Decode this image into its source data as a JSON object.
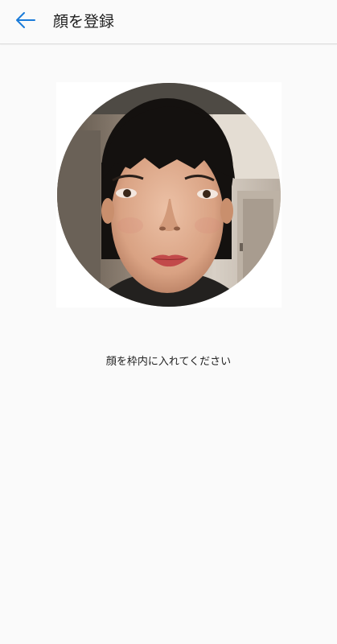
{
  "header": {
    "title": "顔を登録",
    "back_icon": "arrow-left-icon",
    "accent_color": "#1a7bd9"
  },
  "main": {
    "instruction": "顔を枠内に入れてください"
  },
  "colors": {
    "background": "#fafafa",
    "frame_background": "#ffffff",
    "title_text": "#202020",
    "body_text": "#222222"
  }
}
